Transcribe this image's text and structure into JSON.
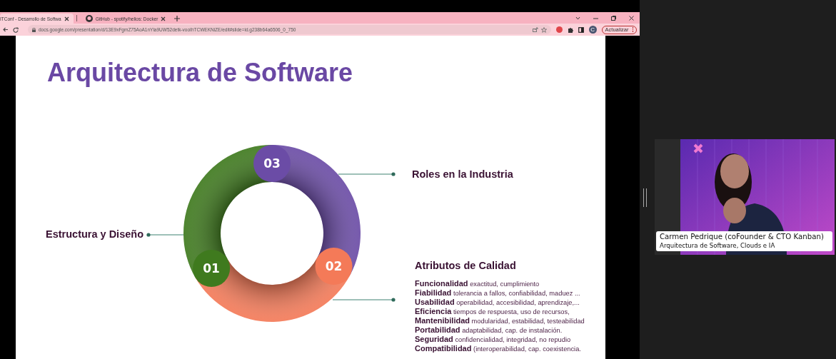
{
  "browser": {
    "tabs": [
      {
        "title": "ITConf - Desarrollo de Softwa",
        "selected": true
      },
      {
        "title": "GitHub - spotify/helios: Docker",
        "selected": false
      }
    ],
    "url": "docs.google.com/presentation/d/13E9xFgmZ75AoA1nYla9UW52detk-vooIhTCWEKNiZE/edit#slide=id.g238b64a6506_0_750",
    "profile": "C",
    "update_button": "Actualizar"
  },
  "slide": {
    "title": "Arquitectura de Software",
    "segments": [
      {
        "number": "03",
        "label": "Roles en la Industria",
        "color": "#6b4ca6"
      },
      {
        "number": "01",
        "label": "Estructura y Diseño",
        "color": "#3f7a1e"
      },
      {
        "number": "02",
        "label": "Atributos de Calidad",
        "color": "#f47a58",
        "attributes": [
          "**Funcionalidad** exactitud, cumplimiento",
          "**Fiabilidad** tolerancia a fallos, confiabilidad, maduez ...",
          "**Usabilidad** operabilidad, accesibilidad, aprendizaje,...",
          "**Eficiencia** tiempos de respuesta, uso de recursos,",
          "**Mantenibilidad** modularidad, estabilidad, testeabilidad",
          "**Portabilidad** adaptabilidad, cap. de instalación.",
          "**Seguridad** confidencialidad, integridad, no repudio",
          "**Compatibilidad** (interoperabilidad, cap. coexistencia."
        ]
      }
    ]
  },
  "webcam": {
    "name": "Carmen Pedrique (coFounder & CTO Kanban)",
    "subtitle": "Arquitectura de Software, Clouds e IA"
  }
}
